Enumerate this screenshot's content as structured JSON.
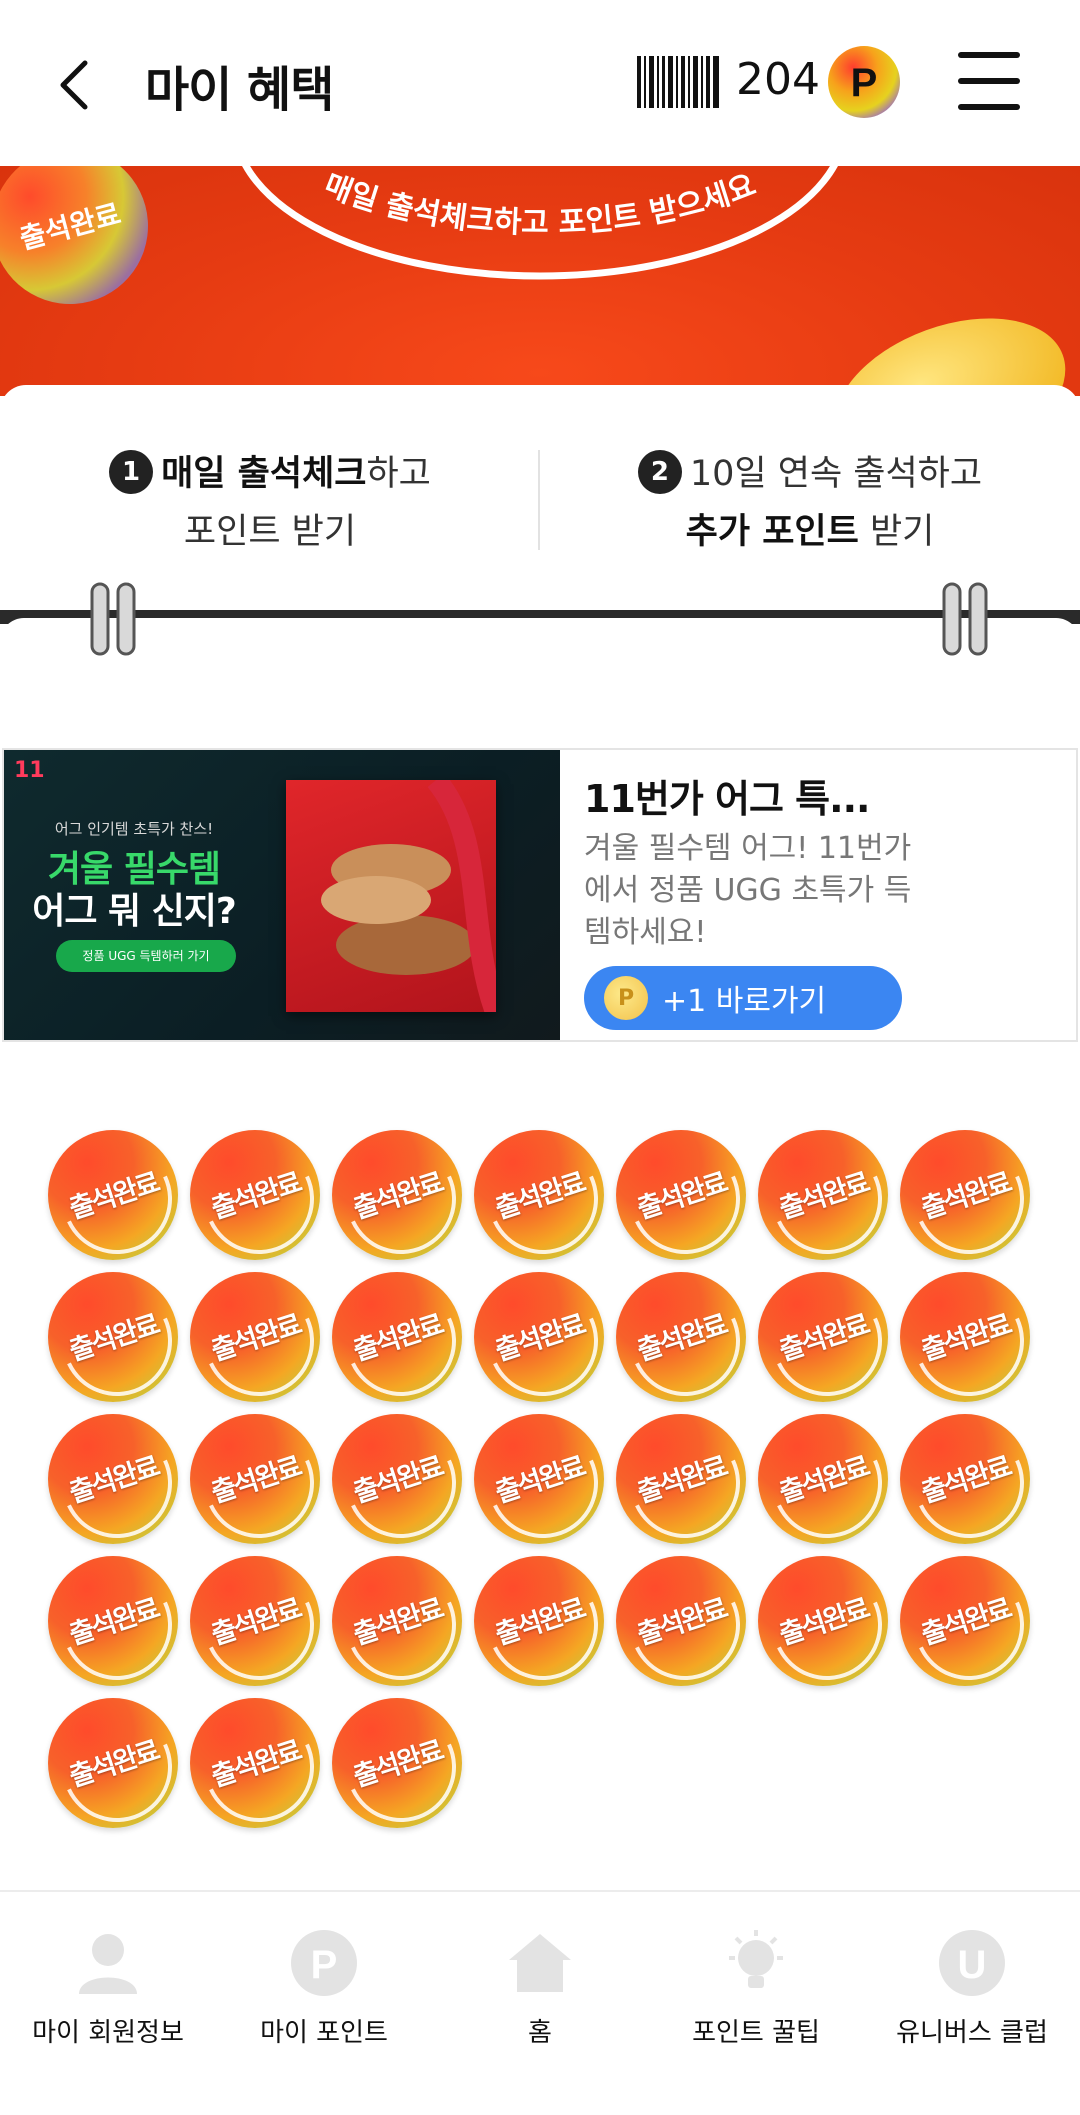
{
  "header": {
    "title": "마이 혜택",
    "point_count": "204",
    "point_coin_letter": "P"
  },
  "banner": {
    "arc_text": "매일 출석체크하고 포인트 받으세요",
    "corner_stamp_text": "출석완료",
    "bg_color": "#e63b12"
  },
  "info": {
    "step1": {
      "num": "1",
      "bold": "매일 출석체크",
      "rest": "하고",
      "line2": "포인트 받기"
    },
    "step2": {
      "num": "2",
      "line1": "10일 연속 출석하고",
      "bold": "추가 포인트",
      "rest": " 받기"
    }
  },
  "ad": {
    "image": {
      "logo": "11",
      "small_line": "어그 인기템 초특가 찬스!",
      "headline1": "겨울 필수템",
      "headline2": "어그 뭐 신지?",
      "cta": "정품 UGG 득템하러 가기"
    },
    "title": "11번가 어그 특...",
    "description": "겨울 필수템 어그! 11번가에서 정품 UGG 초특가 득템하세요!",
    "button_label": "+1 바로가기",
    "button_coin_letter": "P",
    "button_color": "#3b86f2"
  },
  "stamps": {
    "label": "출석완료",
    "count": 31,
    "columns": 7
  },
  "bottom_nav": {
    "items": [
      {
        "label": "마이 회원정보",
        "icon": "person-icon"
      },
      {
        "label": "마이 포인트",
        "icon": "point-icon"
      },
      {
        "label": "홈",
        "icon": "home-icon"
      },
      {
        "label": "포인트 꿀팁",
        "icon": "lightbulb-icon"
      },
      {
        "label": "유니버스 클럽",
        "icon": "universe-club-icon"
      }
    ]
  }
}
